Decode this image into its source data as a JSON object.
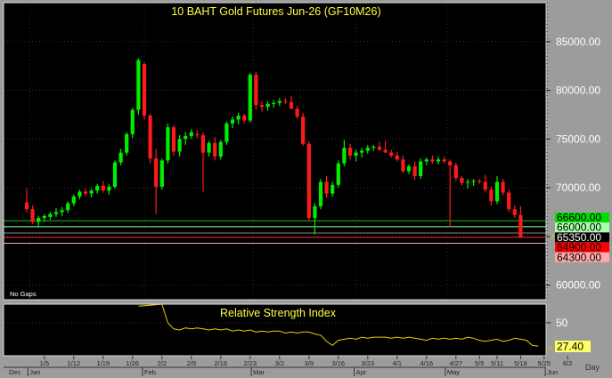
{
  "chart_data": [
    {
      "type": "candlestick",
      "title": "10  BAHT  Gold  Futures  Jun-26  (GF10M26)",
      "note": "No  Gaps",
      "ylim": [
        58500,
        89000
      ],
      "y_ticks": [
        {
          "value": 60000,
          "label": "60000.00"
        },
        {
          "value": 65000,
          "label": "65000.00"
        },
        {
          "value": 70000,
          "label": "70000.00"
        },
        {
          "value": 75000,
          "label": "75000.00"
        },
        {
          "value": 80000,
          "label": "80000.00"
        },
        {
          "value": 85000,
          "label": "85000.00"
        }
      ],
      "levels": [
        {
          "value": 66600,
          "label": "66600.00",
          "color": "#00cc00",
          "label_bg": "#00dd00",
          "label_fg": "#000000"
        },
        {
          "value": 66000,
          "label": "66000.00",
          "color": "#aaffaa",
          "label_bg": "#aaffaa",
          "label_fg": "#000000"
        },
        {
          "value": 65350,
          "label": "65350.00",
          "color": "#888888",
          "label_bg": "#000000",
          "label_fg": "#ffffff"
        },
        {
          "value": 64900,
          "label": "64900.00",
          "color": "#ff2222",
          "label_bg": "#ff0000",
          "label_fg": "#000000"
        },
        {
          "value": 64300,
          "label": "64300.00",
          "color": "#ffaaaa",
          "label_bg": "#ffaaaa",
          "label_fg": "#000000"
        }
      ],
      "up_color": "#00ee00",
      "down_color": "#ff1a1a",
      "candles": [
        [
          68500,
          69900,
          67500,
          67800
        ],
        [
          67800,
          68200,
          66300,
          66500
        ],
        [
          66500,
          67100,
          65900,
          66900
        ],
        [
          66900,
          67300,
          66500,
          67100
        ],
        [
          67000,
          67500,
          66700,
          67300
        ],
        [
          67300,
          67900,
          67000,
          67500
        ],
        [
          67500,
          68000,
          67100,
          67700
        ],
        [
          67700,
          68600,
          67400,
          68400
        ],
        [
          68400,
          69300,
          68100,
          69100
        ],
        [
          69100,
          69800,
          68800,
          69600
        ],
        [
          69600,
          69900,
          69200,
          69400
        ],
        [
          69400,
          69900,
          69000,
          69700
        ],
        [
          69700,
          70400,
          69400,
          70200
        ],
        [
          70200,
          70700,
          69500,
          69700
        ],
        [
          69700,
          70400,
          69300,
          70100
        ],
        [
          70100,
          72800,
          69900,
          72600
        ],
        [
          72600,
          74000,
          72300,
          73600
        ],
        [
          73600,
          75700,
          73300,
          75500
        ],
        [
          75500,
          78200,
          75100,
          78000
        ],
        [
          78000,
          83300,
          77500,
          83100
        ],
        [
          82700,
          82900,
          77000,
          77400
        ],
        [
          77400,
          77600,
          72500,
          73000
        ],
        [
          73000,
          74000,
          67300,
          70100
        ],
        [
          70100,
          73000,
          69800,
          72800
        ],
        [
          72800,
          76600,
          72500,
          76200
        ],
        [
          76200,
          76400,
          73300,
          73700
        ],
        [
          73700,
          75400,
          73200,
          75000
        ],
        [
          75000,
          75700,
          74400,
          75300
        ],
        [
          75300,
          76000,
          75000,
          75700
        ],
        [
          75500,
          75900,
          75100,
          75400
        ],
        [
          75400,
          75700,
          69600,
          73600
        ],
        [
          73600,
          74800,
          73200,
          74600
        ],
        [
          74600,
          75200,
          72800,
          73200
        ],
        [
          73200,
          74900,
          72900,
          74700
        ],
        [
          74700,
          76800,
          74400,
          76600
        ],
        [
          76600,
          77300,
          76100,
          77000
        ],
        [
          77000,
          77700,
          76500,
          77400
        ],
        [
          77400,
          77600,
          76600,
          76900
        ],
        [
          76900,
          81800,
          76700,
          81600
        ],
        [
          81600,
          81900,
          78000,
          78500
        ],
        [
          78500,
          78900,
          77800,
          78300
        ],
        [
          78300,
          78900,
          77900,
          78600
        ],
        [
          78600,
          79000,
          78200,
          78700
        ],
        [
          78700,
          79200,
          78400,
          78900
        ],
        [
          78900,
          79200,
          78600,
          78800
        ],
        [
          78800,
          79400,
          78300,
          78100
        ],
        [
          78100,
          78400,
          77100,
          77300
        ],
        [
          77300,
          77700,
          74300,
          74500
        ],
        [
          74500,
          74800,
          66600,
          66900
        ],
        [
          66900,
          68400,
          65200,
          68100
        ],
        [
          68100,
          70900,
          67800,
          70600
        ],
        [
          70600,
          71200,
          69000,
          69400
        ],
        [
          69400,
          70600,
          69100,
          70300
        ],
        [
          70300,
          72800,
          70000,
          72500
        ],
        [
          72500,
          74900,
          72200,
          74100
        ],
        [
          74100,
          74500,
          72900,
          73300
        ],
        [
          73300,
          73900,
          72700,
          73600
        ],
        [
          73600,
          74100,
          73100,
          73800
        ],
        [
          73800,
          74400,
          73500,
          74100
        ],
        [
          74100,
          74400,
          73800,
          74200
        ],
        [
          74200,
          74700,
          73800,
          73900
        ],
        [
          73900,
          74800,
          73600,
          73600
        ],
        [
          73600,
          73900,
          73100,
          73300
        ],
        [
          73300,
          73700,
          72700,
          72900
        ],
        [
          72900,
          73300,
          71500,
          71700
        ],
        [
          71700,
          72400,
          71400,
          72200
        ],
        [
          72200,
          72700,
          70800,
          71200
        ],
        [
          71200,
          73000,
          70900,
          72700
        ],
        [
          72700,
          73100,
          72300,
          72900
        ],
        [
          72900,
          73300,
          72500,
          72700
        ],
        [
          72700,
          73200,
          72400,
          72900
        ],
        [
          72900,
          73200,
          72500,
          72700
        ],
        [
          72700,
          72900,
          66000,
          72300
        ],
        [
          72300,
          72600,
          70700,
          71000
        ],
        [
          71000,
          71200,
          70200,
          70500
        ],
        [
          70500,
          70900,
          69900,
          70600
        ],
        [
          70600,
          70900,
          70200,
          70700
        ],
        [
          70700,
          70900,
          70400,
          70600
        ],
        [
          70600,
          71300,
          69500,
          69800
        ],
        [
          69800,
          70100,
          68200,
          68600
        ],
        [
          68600,
          71200,
          68300,
          70600
        ],
        [
          70600,
          70900,
          69200,
          69500
        ],
        [
          69500,
          69800,
          67500,
          67800
        ],
        [
          67800,
          68200,
          66900,
          67200
        ],
        [
          67200,
          68100,
          65300,
          64900
        ]
      ]
    },
    {
      "type": "line",
      "title": "Relative  Strength  Index",
      "ylim": [
        18,
        68
      ],
      "y_ticks": [
        {
          "value": 50,
          "label": "50"
        }
      ],
      "last_value": 27.4,
      "last_label": "27.40",
      "color": "#e6d200",
      "start_index": 19,
      "values": [
        66,
        66.5,
        67,
        67.5,
        68,
        50,
        44,
        43,
        45,
        44,
        45,
        44,
        43,
        44,
        43,
        44,
        42,
        43,
        42,
        43,
        41,
        42,
        41,
        42,
        42,
        40,
        41,
        40,
        41,
        41,
        39,
        38,
        32,
        28,
        33,
        34,
        35,
        34,
        36,
        35,
        36,
        36,
        36,
        35,
        36,
        35,
        36,
        35,
        34,
        33,
        35,
        34,
        35,
        34,
        35,
        34,
        36,
        35,
        33,
        32,
        33,
        34,
        32,
        33,
        35,
        34,
        33,
        28,
        27.4
      ]
    }
  ],
  "x_axis": {
    "label": "Day",
    "month_labels": [
      {
        "label": "Dec",
        "index": -2.5
      },
      {
        "label": "Jan",
        "index": 2
      },
      {
        "label": "Feb",
        "index": 21.5
      },
      {
        "label": "Mar",
        "index": 40
      },
      {
        "label": "Apr",
        "index": 57.5
      },
      {
        "label": "May",
        "index": 73
      },
      {
        "label": "Jun",
        "index": 90
      }
    ],
    "day_labels": [
      {
        "label": "1/5",
        "index": 3
      },
      {
        "label": "1/12",
        "index": 8
      },
      {
        "label": "1/19",
        "index": 13
      },
      {
        "label": "1/26",
        "index": 18
      },
      {
        "label": "2/2",
        "index": 23
      },
      {
        "label": "2/9",
        "index": 28
      },
      {
        "label": "2/16",
        "index": 33
      },
      {
        "label": "2/23",
        "index": 38
      },
      {
        "label": "3/2",
        "index": 43
      },
      {
        "label": "3/9",
        "index": 48
      },
      {
        "label": "3/16",
        "index": 53
      },
      {
        "label": "3/23",
        "index": 58
      },
      {
        "label": "4/1",
        "index": 63
      },
      {
        "label": "4/16",
        "index": 68
      },
      {
        "label": "4/27",
        "index": 73
      },
      {
        "label": "5/5",
        "index": 77
      },
      {
        "label": "5/11",
        "index": 80
      },
      {
        "label": "5/18",
        "index": 84
      },
      {
        "label": "5/25",
        "index": 88
      },
      {
        "label": "6/2",
        "index": 92
      }
    ]
  }
}
